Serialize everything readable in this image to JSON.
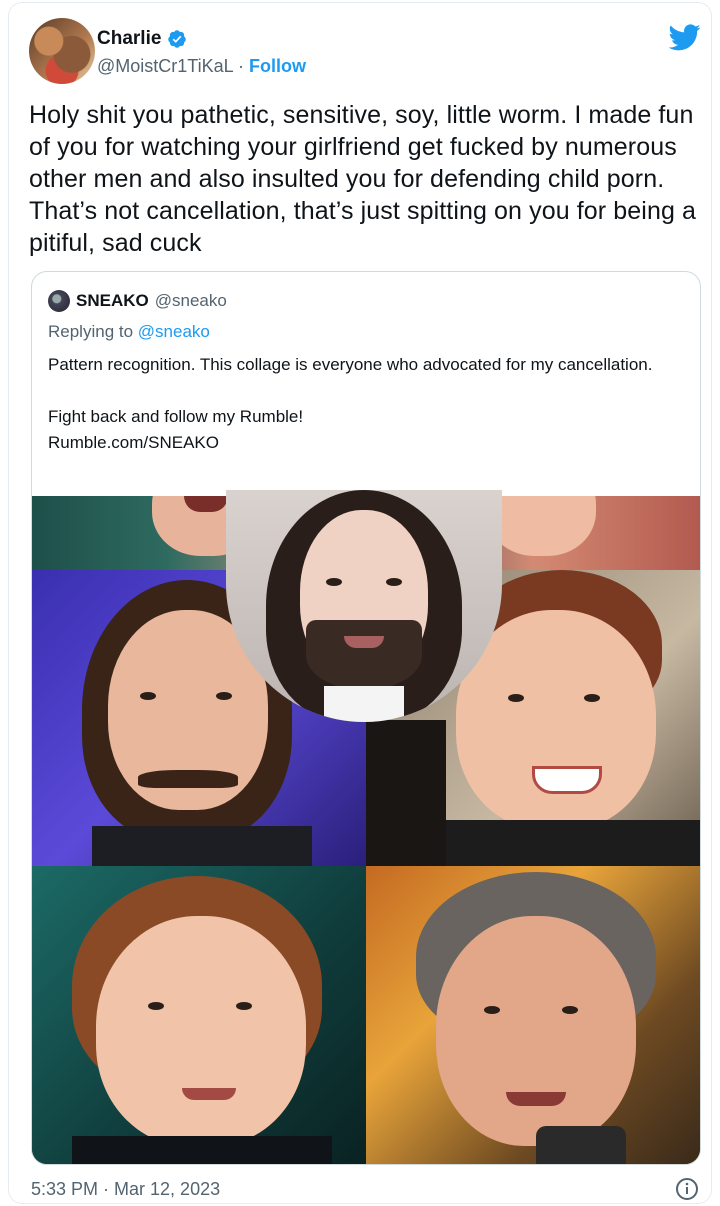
{
  "author": {
    "name": "Charlie",
    "handle": "@MoistCr1TiKaL",
    "separator": "·",
    "follow_label": "Follow"
  },
  "tweet": {
    "text": "Holy shit you pathetic, sensitive, soy, little worm. I made fun of you for watching your girlfriend get fucked by numerous other men and also insulted you for defending child porn. That’s not cancellation, that’s just spitting on you for being a pitiful, sad cuck",
    "timestamp": "5:33 PM · Mar 12, 2023"
  },
  "quoted": {
    "name": "SNEAKO",
    "handle": "@sneako",
    "replying_prefix": "Replying to",
    "replying_to": "@sneako",
    "line1": "Pattern recognition. This collage is everyone who advocated for my cancellation.",
    "line2": "Fight back and follow my Rumble!",
    "line3": "Rumble.com/SNEAKO"
  },
  "icons": {
    "verified": "verified-badge-icon",
    "brand": "twitter-bird-icon",
    "info": "info-icon"
  },
  "colors": {
    "accent": "#1d9bf0",
    "text": "#0f1419",
    "muted": "#536471"
  }
}
